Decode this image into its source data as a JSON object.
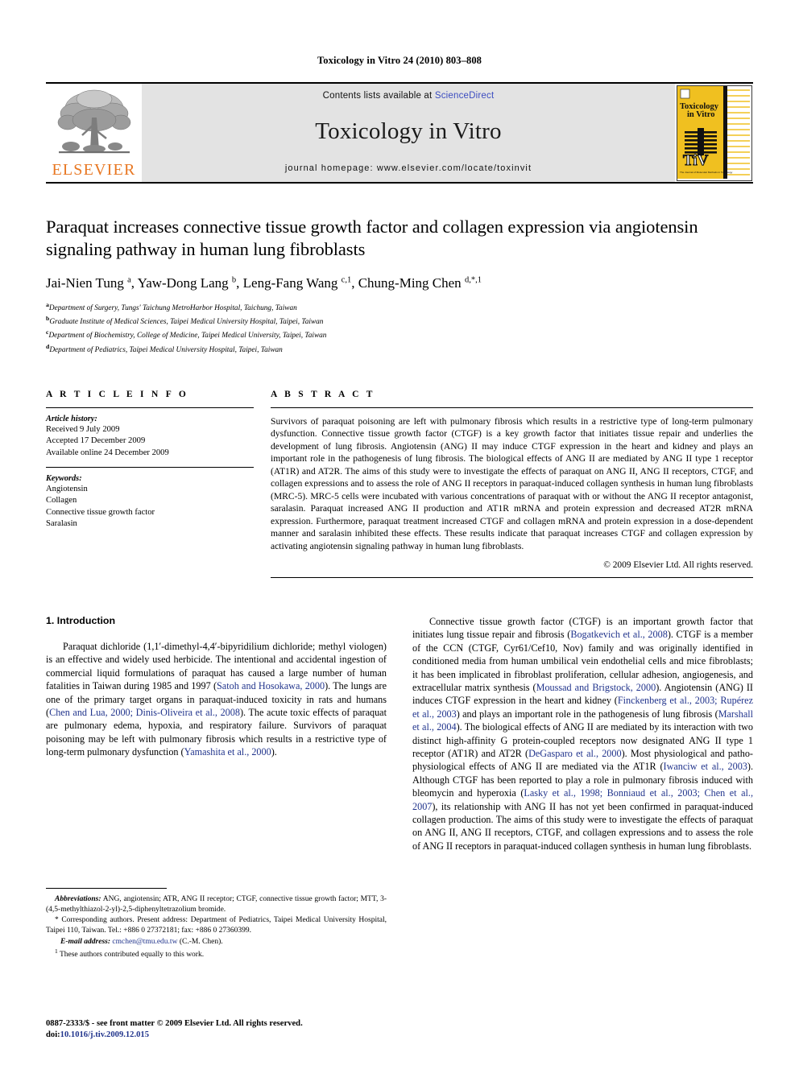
{
  "running_head": "Toxicology in Vitro 24 (2010) 803–808",
  "masthead": {
    "publisher_name": "ELSEVIER",
    "contents_prefix": "Contents lists available at ",
    "sciencedirect_label": "ScienceDirect",
    "journal_title": "Toxicology in Vitro",
    "homepage_line": "journal homepage: www.elsevier.com/locate/toxinvit",
    "cover_title_line1": "Toxicology",
    "cover_title_line2": "in Vitro",
    "cover_logo_text": "TiV",
    "cover_caption": "The Journal of Molecular Methods in Toxicology",
    "link_color": "#3b4cc0",
    "elsevier_orange": "#E87722",
    "cover_yellow": "#F0C020"
  },
  "article": {
    "title": "Paraquat increases connective tissue growth factor and collagen expression via angiotensin signaling pathway in human lung fibroblasts",
    "authors_html": "Jai-Nien Tung <sup>a</sup>, Yaw-Dong Lang <sup>b</sup>, Leng-Fang Wang <sup>c,1</sup>, Chung-Ming Chen <sup>d,*,1</sup>",
    "affiliations": [
      {
        "marker": "a",
        "text": "Department of Surgery, Tungs' Taichung MetroHarbor Hospital, Taichung, Taiwan"
      },
      {
        "marker": "b",
        "text": "Graduate Institute of Medical Sciences, Taipei Medical University Hospital, Taipei, Taiwan"
      },
      {
        "marker": "c",
        "text": "Department of Biochemistry, College of Medicine, Taipei Medical University, Taipei, Taiwan"
      },
      {
        "marker": "d",
        "text": "Department of Pediatrics, Taipei Medical University Hospital, Taipei, Taiwan"
      }
    ]
  },
  "article_info": {
    "heading": "A R T I C L E   I N F O",
    "history_label": "Article history:",
    "history_lines": [
      "Received 9 July 2009",
      "Accepted 17 December 2009",
      "Available online 24 December 2009"
    ],
    "keywords_label": "Keywords:",
    "keywords": [
      "Angiotensin",
      "Collagen",
      "Connective tissue growth factor",
      "Saralasin"
    ]
  },
  "abstract": {
    "heading": "A B S T R A C T",
    "text": "Survivors of paraquat poisoning are left with pulmonary fibrosis which results in a restrictive type of long-term pulmonary dysfunction. Connective tissue growth factor (CTGF) is a key growth factor that initiates tissue repair and underlies the development of lung fibrosis. Angiotensin (ANG) II may induce CTGF expression in the heart and kidney and plays an important role in the pathogenesis of lung fibrosis. The biological effects of ANG II are mediated by ANG II type 1 receptor (AT1R) and AT2R. The aims of this study were to investigate the effects of paraquat on ANG II, ANG II receptors, CTGF, and collagen expressions and to assess the role of ANG II receptors in paraquat-induced collagen synthesis in human lung fibroblasts (MRC-5). MRC-5 cells were incubated with various concentrations of paraquat with or without the ANG II receptor antagonist, saralasin. Paraquat increased ANG II production and AT1R mRNA and protein expression and decreased AT2R mRNA expression. Furthermore, paraquat treatment increased CTGF and collagen mRNA and protein expression in a dose-dependent manner and saralasin inhibited these effects. These results indicate that paraquat increases CTGF and collagen expression by activating angiotensin signaling pathway in human lung fibroblasts.",
    "copyright": "© 2009 Elsevier Ltd. All rights reserved."
  },
  "introduction": {
    "heading": "1. Introduction",
    "left_paragraph_parts": [
      {
        "t": "Paraquat dichloride (1,1′-dimethyl-4,4′-bipyridilium dichloride; methyl viologen) is an effective and widely used herbicide. The intentional and accidental ingestion of commercial liquid formulations of paraquat has caused a large number of human fatalities in Taiwan during 1985 and 1997 (",
        "cite": false
      },
      {
        "t": "Satoh and Hosokawa, 2000",
        "cite": true
      },
      {
        "t": "). The lungs are one of the primary target organs in paraquat-induced toxicity in rats and humans (",
        "cite": false
      },
      {
        "t": "Chen and Lua, 2000; Dinis-Oliveira et al., 2008",
        "cite": true
      },
      {
        "t": "). The acute toxic effects of paraquat are pulmonary edema, hypoxia, and respiratory failure. Survivors of paraquat poisoning may be left with pulmonary fibrosis which results in a restrictive type of long-term pulmonary dysfunction (",
        "cite": false
      },
      {
        "t": "Yamashita et al., 2000",
        "cite": true
      },
      {
        "t": ").",
        "cite": false
      }
    ],
    "right_paragraph_parts": [
      {
        "t": "Connective tissue growth factor (CTGF) is an important growth factor that initiates lung tissue repair and fibrosis (",
        "cite": false
      },
      {
        "t": "Bogatkevich et al., 2008",
        "cite": true
      },
      {
        "t": "). CTGF is a member of the CCN (CTGF, Cyr61/Cef10, Nov) family and was originally identified in conditioned media from human umbilical vein endothelial cells and mice fibroblasts; it has been implicated in fibroblast proliferation, cellular adhesion, angiogenesis, and extracellular matrix synthesis (",
        "cite": false
      },
      {
        "t": "Moussad and Brigstock, 2000",
        "cite": true
      },
      {
        "t": "). Angiotensin (ANG) II induces CTGF expression in the heart and kidney (",
        "cite": false
      },
      {
        "t": "Finckenberg et al., 2003; Rupérez et al., 2003",
        "cite": true
      },
      {
        "t": ") and plays an important role in the pathogenesis of lung fibrosis (",
        "cite": false
      },
      {
        "t": "Marshall et al., 2004",
        "cite": true
      },
      {
        "t": "). The biological effects of ANG II are mediated by its interaction with two distinct high-affinity G protein-coupled receptors now designated ANG II type 1 receptor (AT1R) and AT2R (",
        "cite": false
      },
      {
        "t": "DeGasparo et al., 2000",
        "cite": true
      },
      {
        "t": "). Most physiological and patho-physiological effects of ANG II are mediated via the AT1R (",
        "cite": false
      },
      {
        "t": "Iwanciw et al., 2003",
        "cite": true
      },
      {
        "t": "). Although CTGF has been reported to play a role in pulmonary fibrosis induced with bleomycin and hyperoxia (",
        "cite": false
      },
      {
        "t": "Lasky et al., 1998; Bonniaud et al., 2003; Chen et al., 2007",
        "cite": true
      },
      {
        "t": "), its relationship with ANG II has not yet been confirmed in paraquat-induced collagen production. The aims of this study were to investigate the effects of paraquat on ANG II, ANG II receptors, CTGF, and collagen expressions and to assess the role of ANG II receptors in paraquat-induced collagen synthesis in human lung fibroblasts.",
        "cite": false
      }
    ]
  },
  "footnotes": {
    "abbreviations_label": "Abbreviations:",
    "abbreviations_text": " ANG, angiotensin; ATR, ANG II receptor; CTGF, connective tissue growth factor; MTT, 3-(4,5-methylthiazol-2-yl)-2,5-diphenyltetrazolium bromide.",
    "corresponding_marker": "*",
    "corresponding_text": " Corresponding authors. Present address: Department of Pediatrics, Taipei Medical University Hospital, Taipei 110, Taiwan. Tel.: +886 0 27372181; fax: +886 0 27360399.",
    "email_label": "E-mail address:",
    "email_value": "cmchen@tmu.edu.tw",
    "email_suffix": " (C.-M. Chen).",
    "equal_marker": "1",
    "equal_text": " These authors contributed equally to this work."
  },
  "page_footer": {
    "front_matter": "0887-2333/$ - see front matter © 2009 Elsevier Ltd. All rights reserved.",
    "doi_label": "doi:",
    "doi_value": "10.1016/j.tiv.2009.12.015"
  }
}
